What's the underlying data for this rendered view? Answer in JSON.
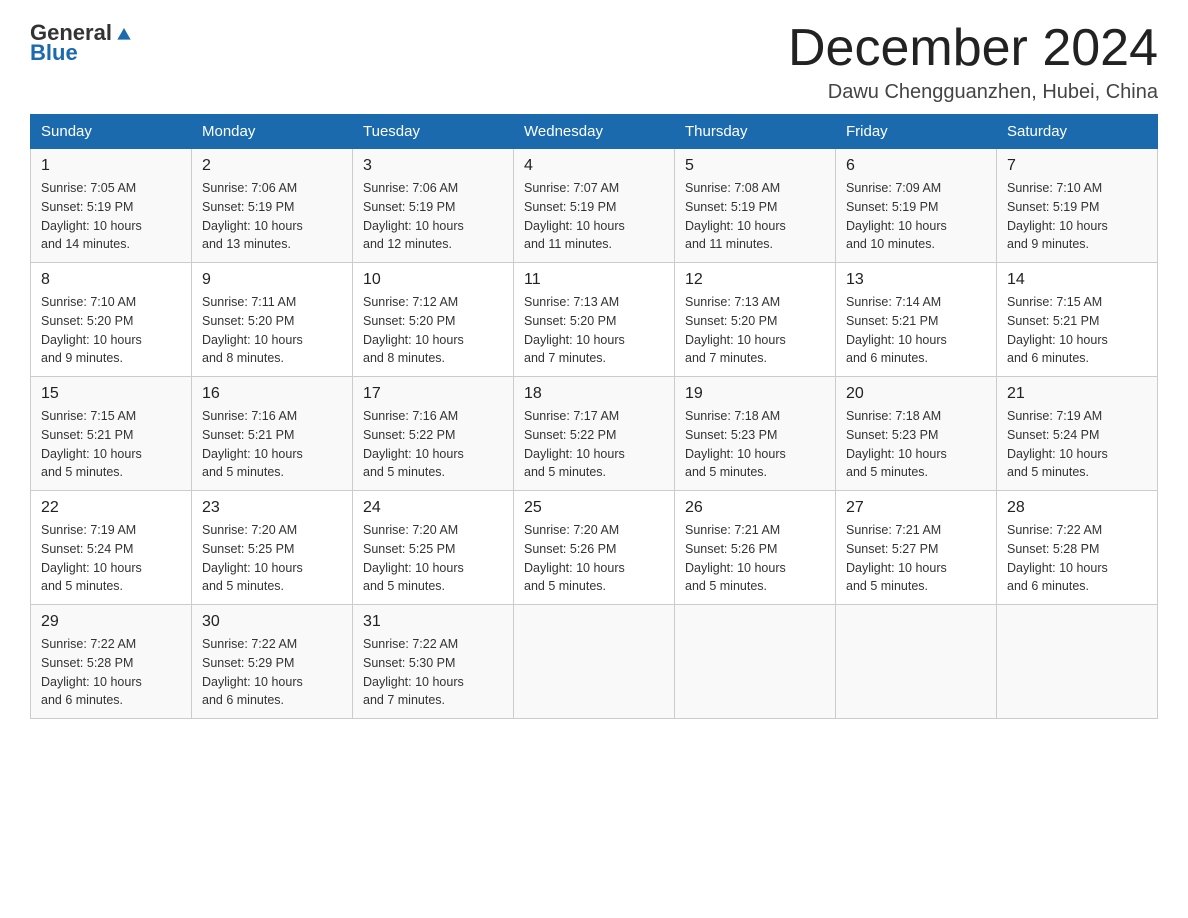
{
  "header": {
    "logo_general": "General",
    "logo_blue": "Blue",
    "month_title": "December 2024",
    "location": "Dawu Chengguanzhen, Hubei, China"
  },
  "days_of_week": [
    "Sunday",
    "Monday",
    "Tuesday",
    "Wednesday",
    "Thursday",
    "Friday",
    "Saturday"
  ],
  "weeks": [
    [
      {
        "day": "1",
        "sunrise": "7:05 AM",
        "sunset": "5:19 PM",
        "daylight": "10 hours and 14 minutes."
      },
      {
        "day": "2",
        "sunrise": "7:06 AM",
        "sunset": "5:19 PM",
        "daylight": "10 hours and 13 minutes."
      },
      {
        "day": "3",
        "sunrise": "7:06 AM",
        "sunset": "5:19 PM",
        "daylight": "10 hours and 12 minutes."
      },
      {
        "day": "4",
        "sunrise": "7:07 AM",
        "sunset": "5:19 PM",
        "daylight": "10 hours and 11 minutes."
      },
      {
        "day": "5",
        "sunrise": "7:08 AM",
        "sunset": "5:19 PM",
        "daylight": "10 hours and 11 minutes."
      },
      {
        "day": "6",
        "sunrise": "7:09 AM",
        "sunset": "5:19 PM",
        "daylight": "10 hours and 10 minutes."
      },
      {
        "day": "7",
        "sunrise": "7:10 AM",
        "sunset": "5:19 PM",
        "daylight": "10 hours and 9 minutes."
      }
    ],
    [
      {
        "day": "8",
        "sunrise": "7:10 AM",
        "sunset": "5:20 PM",
        "daylight": "10 hours and 9 minutes."
      },
      {
        "day": "9",
        "sunrise": "7:11 AM",
        "sunset": "5:20 PM",
        "daylight": "10 hours and 8 minutes."
      },
      {
        "day": "10",
        "sunrise": "7:12 AM",
        "sunset": "5:20 PM",
        "daylight": "10 hours and 8 minutes."
      },
      {
        "day": "11",
        "sunrise": "7:13 AM",
        "sunset": "5:20 PM",
        "daylight": "10 hours and 7 minutes."
      },
      {
        "day": "12",
        "sunrise": "7:13 AM",
        "sunset": "5:20 PM",
        "daylight": "10 hours and 7 minutes."
      },
      {
        "day": "13",
        "sunrise": "7:14 AM",
        "sunset": "5:21 PM",
        "daylight": "10 hours and 6 minutes."
      },
      {
        "day": "14",
        "sunrise": "7:15 AM",
        "sunset": "5:21 PM",
        "daylight": "10 hours and 6 minutes."
      }
    ],
    [
      {
        "day": "15",
        "sunrise": "7:15 AM",
        "sunset": "5:21 PM",
        "daylight": "10 hours and 5 minutes."
      },
      {
        "day": "16",
        "sunrise": "7:16 AM",
        "sunset": "5:21 PM",
        "daylight": "10 hours and 5 minutes."
      },
      {
        "day": "17",
        "sunrise": "7:16 AM",
        "sunset": "5:22 PM",
        "daylight": "10 hours and 5 minutes."
      },
      {
        "day": "18",
        "sunrise": "7:17 AM",
        "sunset": "5:22 PM",
        "daylight": "10 hours and 5 minutes."
      },
      {
        "day": "19",
        "sunrise": "7:18 AM",
        "sunset": "5:23 PM",
        "daylight": "10 hours and 5 minutes."
      },
      {
        "day": "20",
        "sunrise": "7:18 AM",
        "sunset": "5:23 PM",
        "daylight": "10 hours and 5 minutes."
      },
      {
        "day": "21",
        "sunrise": "7:19 AM",
        "sunset": "5:24 PM",
        "daylight": "10 hours and 5 minutes."
      }
    ],
    [
      {
        "day": "22",
        "sunrise": "7:19 AM",
        "sunset": "5:24 PM",
        "daylight": "10 hours and 5 minutes."
      },
      {
        "day": "23",
        "sunrise": "7:20 AM",
        "sunset": "5:25 PM",
        "daylight": "10 hours and 5 minutes."
      },
      {
        "day": "24",
        "sunrise": "7:20 AM",
        "sunset": "5:25 PM",
        "daylight": "10 hours and 5 minutes."
      },
      {
        "day": "25",
        "sunrise": "7:20 AM",
        "sunset": "5:26 PM",
        "daylight": "10 hours and 5 minutes."
      },
      {
        "day": "26",
        "sunrise": "7:21 AM",
        "sunset": "5:26 PM",
        "daylight": "10 hours and 5 minutes."
      },
      {
        "day": "27",
        "sunrise": "7:21 AM",
        "sunset": "5:27 PM",
        "daylight": "10 hours and 5 minutes."
      },
      {
        "day": "28",
        "sunrise": "7:22 AM",
        "sunset": "5:28 PM",
        "daylight": "10 hours and 6 minutes."
      }
    ],
    [
      {
        "day": "29",
        "sunrise": "7:22 AM",
        "sunset": "5:28 PM",
        "daylight": "10 hours and 6 minutes."
      },
      {
        "day": "30",
        "sunrise": "7:22 AM",
        "sunset": "5:29 PM",
        "daylight": "10 hours and 6 minutes."
      },
      {
        "day": "31",
        "sunrise": "7:22 AM",
        "sunset": "5:30 PM",
        "daylight": "10 hours and 7 minutes."
      },
      null,
      null,
      null,
      null
    ]
  ],
  "labels": {
    "sunrise": "Sunrise:",
    "sunset": "Sunset:",
    "daylight": "Daylight:"
  }
}
